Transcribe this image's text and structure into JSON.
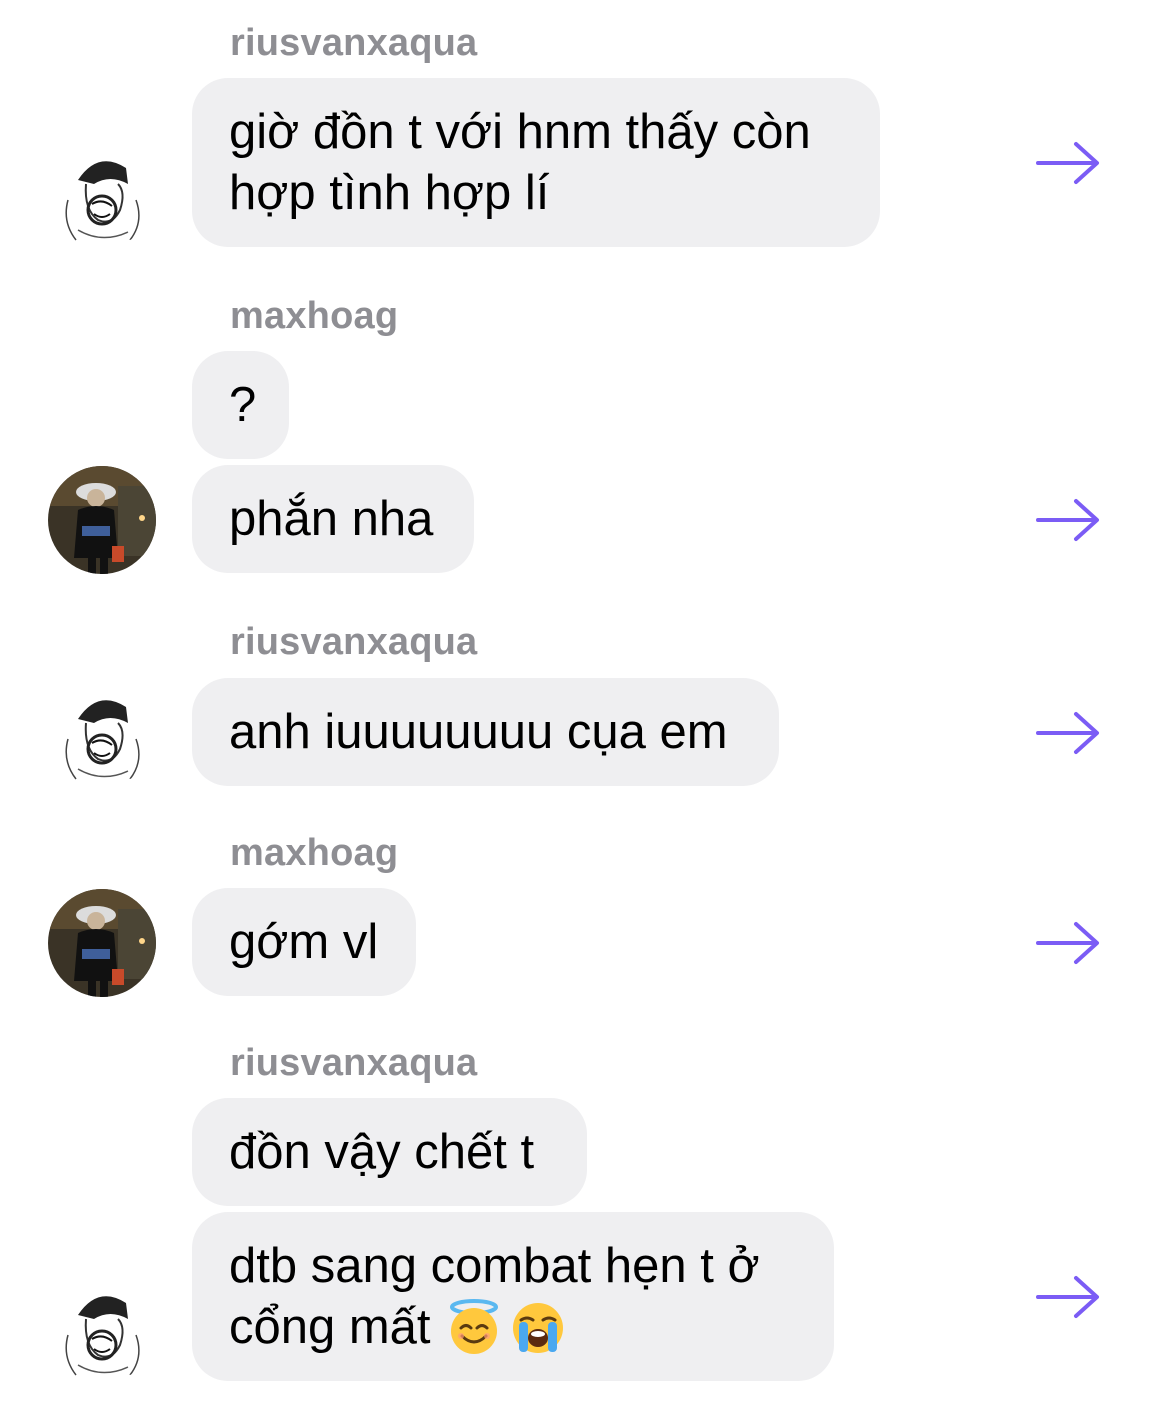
{
  "messages": [
    {
      "sender": "riusvanxaqua",
      "text_lines": [
        "giờ đồn t với hnm thấy còn",
        "hợp tình hợp lí"
      ]
    },
    {
      "sender": "maxhoag",
      "text": "?"
    },
    {
      "text": "phắn nha"
    },
    {
      "sender": "riusvanxaqua",
      "text": "anh iuuuuuuuu cụa em"
    },
    {
      "sender": "maxhoag",
      "text": "gớm vl"
    },
    {
      "sender": "riusvanxaqua",
      "text": "đồn vậy chết t"
    },
    {
      "text_lines": [
        "dtb sang combat hẹn t ở",
        "cổng mất"
      ],
      "emojis": [
        "smiling-face-with-halo",
        "loudly-crying-face"
      ]
    }
  ],
  "icons": {
    "forward": "arrow-right-icon",
    "avatar_riusvanxaqua": "sketch-avatar",
    "avatar_maxhoag": "photo-avatar"
  },
  "colors": {
    "bubble": "#efeff1",
    "sender": "#8e8e93",
    "forward_arrow": "#7b5cf5"
  }
}
